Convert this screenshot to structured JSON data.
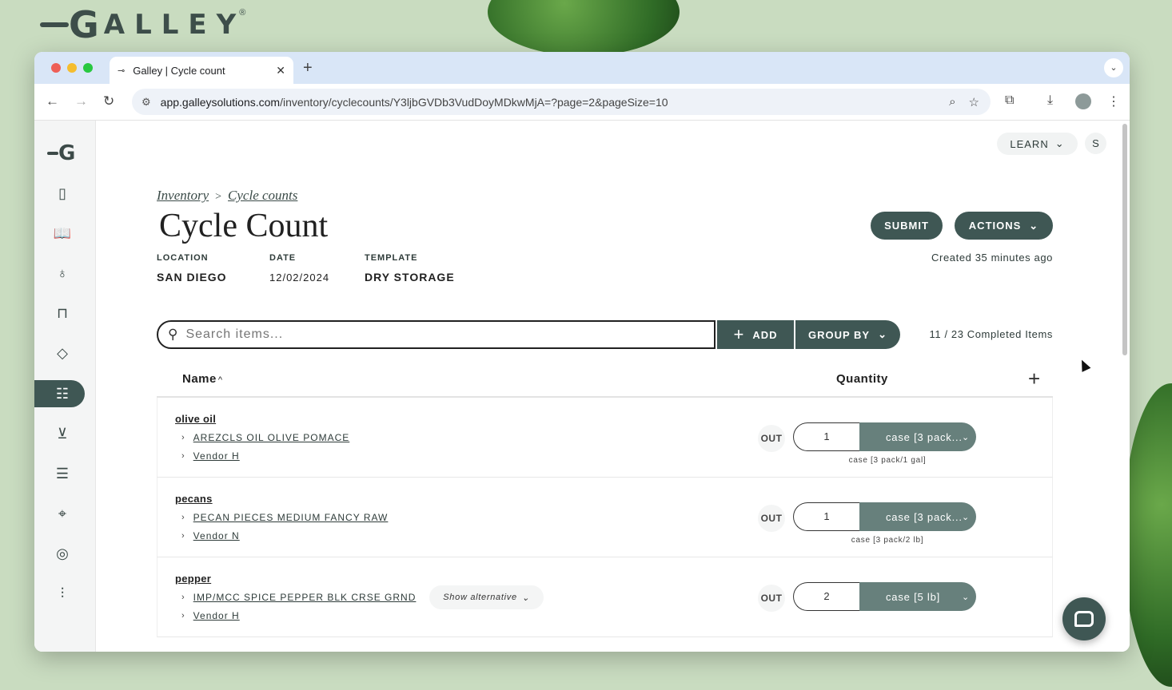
{
  "brand": {
    "name_first": "G",
    "name_rest": "ALLEY",
    "registered": "®"
  },
  "browser": {
    "tab_title": "Galley | Cycle count",
    "url_host": "app.galleysolutions.com",
    "url_path": "/inventory/cyclecounts/Y3ljbGVDb3VudDoyMDkwMjA=?page=2&pageSize=10"
  },
  "header": {
    "learn_label": "LEARN",
    "user_initial": "S"
  },
  "breadcrumb": {
    "parent": "Inventory",
    "separator": ">",
    "current": "Cycle counts"
  },
  "page": {
    "title": "Cycle Count"
  },
  "meta": [
    {
      "label": "LOCATION",
      "value": "SAN DIEGO"
    },
    {
      "label": "DATE",
      "value": "12/02/2024"
    },
    {
      "label": "TEMPLATE",
      "value": "DRY STORAGE"
    }
  ],
  "actions": {
    "submit_label": "SUBMIT",
    "actions_label": "ACTIONS",
    "created_text": "Created  35 minutes ago"
  },
  "toolbar": {
    "search_placeholder": "Search items...",
    "add_label": "ADD",
    "group_by_label": "GROUP BY",
    "completed_text": "11 / 23 Completed Items"
  },
  "table": {
    "col_name": "Name",
    "col_quantity": "Quantity",
    "rows": [
      {
        "name": "olive oil",
        "product": "AREZCLS OIL OLIVE POMACE",
        "vendor": "Vendor H",
        "status": "OUT",
        "quantity": "1",
        "unit": "case [3 pack...",
        "unit_note": "case [3 pack/1 gal]"
      },
      {
        "name": "pecans",
        "product": "PECAN PIECES MEDIUM FANCY RAW",
        "vendor": "Vendor N",
        "status": "OUT",
        "quantity": "1",
        "unit": "case [3 pack...",
        "unit_note": "case [3 pack/2 lb]"
      },
      {
        "name": "pepper",
        "product": "IMP/MCC SPICE PEPPER BLK CRSE GRND",
        "vendor": "Vendor H",
        "alternative_label": "Show alternative",
        "status": "OUT",
        "quantity": "2",
        "unit": "case [5 lb]"
      }
    ]
  },
  "colors": {
    "accent": "#3f5754",
    "unit_bg": "#67807c",
    "backdrop": "#c9dcc0"
  }
}
